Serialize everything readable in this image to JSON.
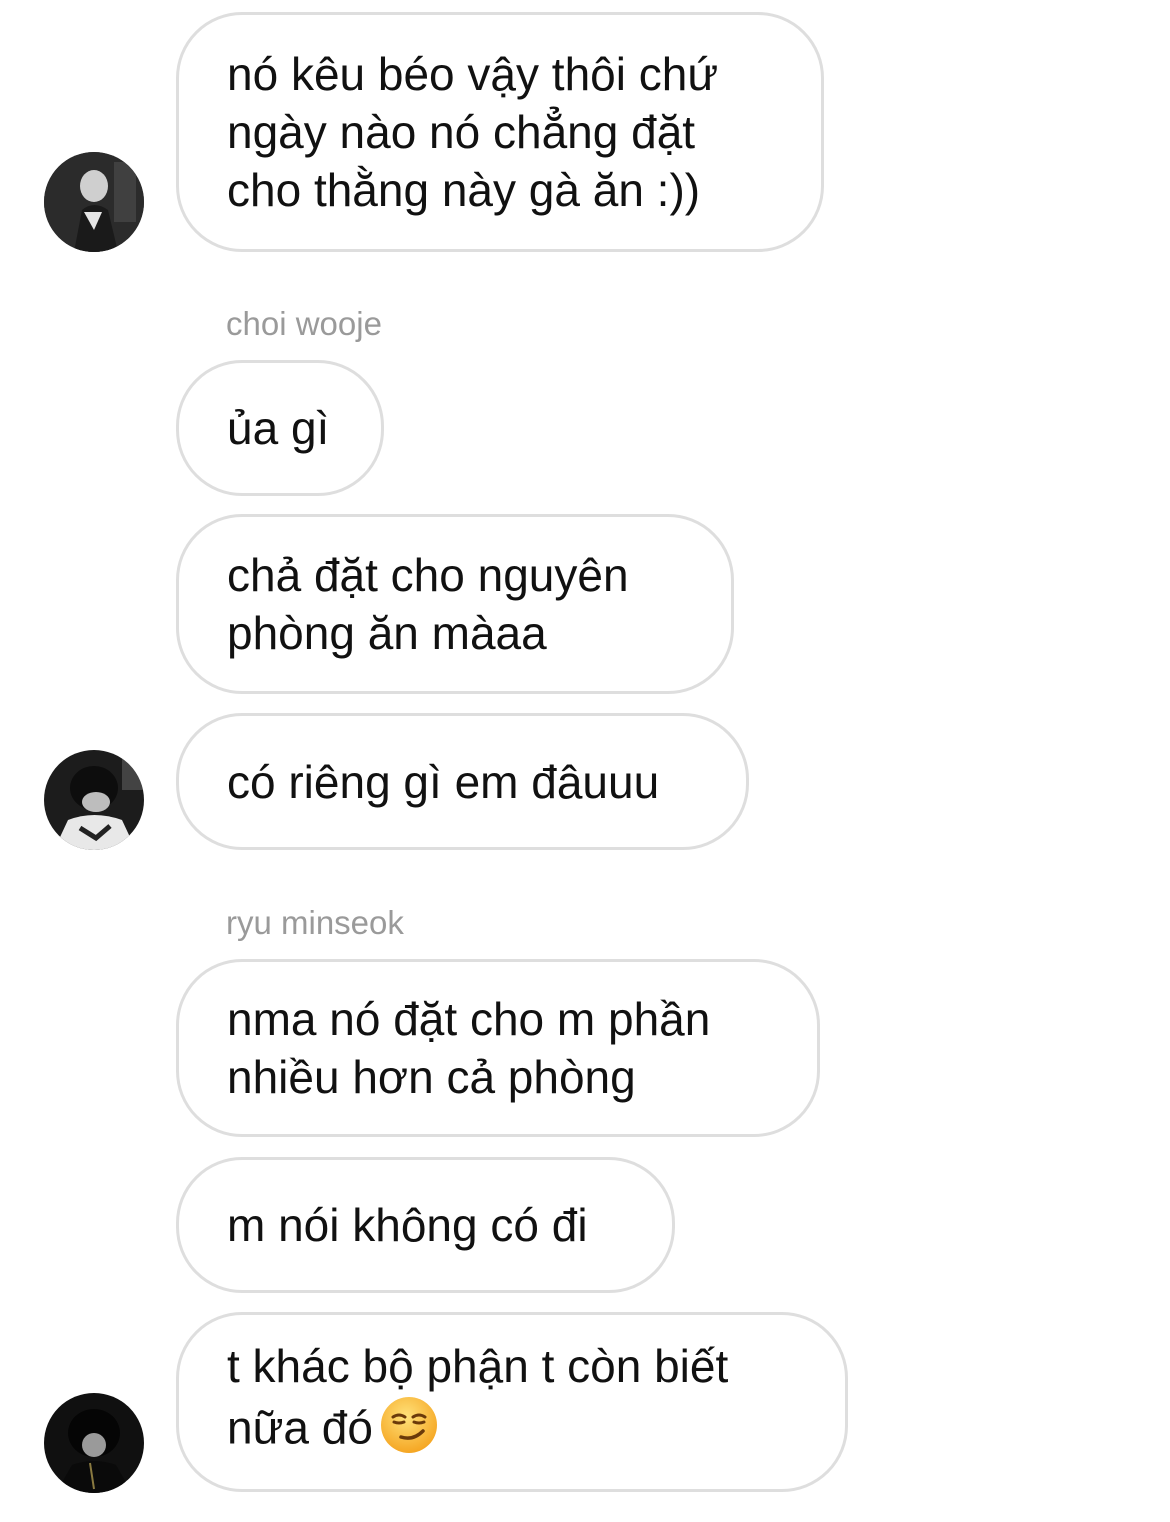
{
  "conversation": {
    "messages": [
      {
        "text": "nó kêu béo vậy thôi chứ ngày nào nó chẳng đặt cho thằng này gà ăn :))"
      },
      {
        "sender": "choi wooje"
      },
      {
        "text": "ủa gì"
      },
      {
        "text": "chả đặt cho nguyên phòng ăn màaa"
      },
      {
        "text": "có riêng gì em đâuuu"
      },
      {
        "sender": "ryu minseok"
      },
      {
        "text": "nma nó đặt cho m phần nhiều hơn cả phòng"
      },
      {
        "text": "m nói không có đi"
      },
      {
        "text": "t khác bộ phận t còn biết nữa đó",
        "emoji": "smirking-face"
      }
    ]
  },
  "avatars": [
    {
      "icon": "user-avatar-1"
    },
    {
      "icon": "user-avatar-2"
    },
    {
      "icon": "user-avatar-3"
    }
  ],
  "colors": {
    "bubble_border": "#dedede",
    "sender_text": "#9a9a9a",
    "message_text": "#111111"
  }
}
